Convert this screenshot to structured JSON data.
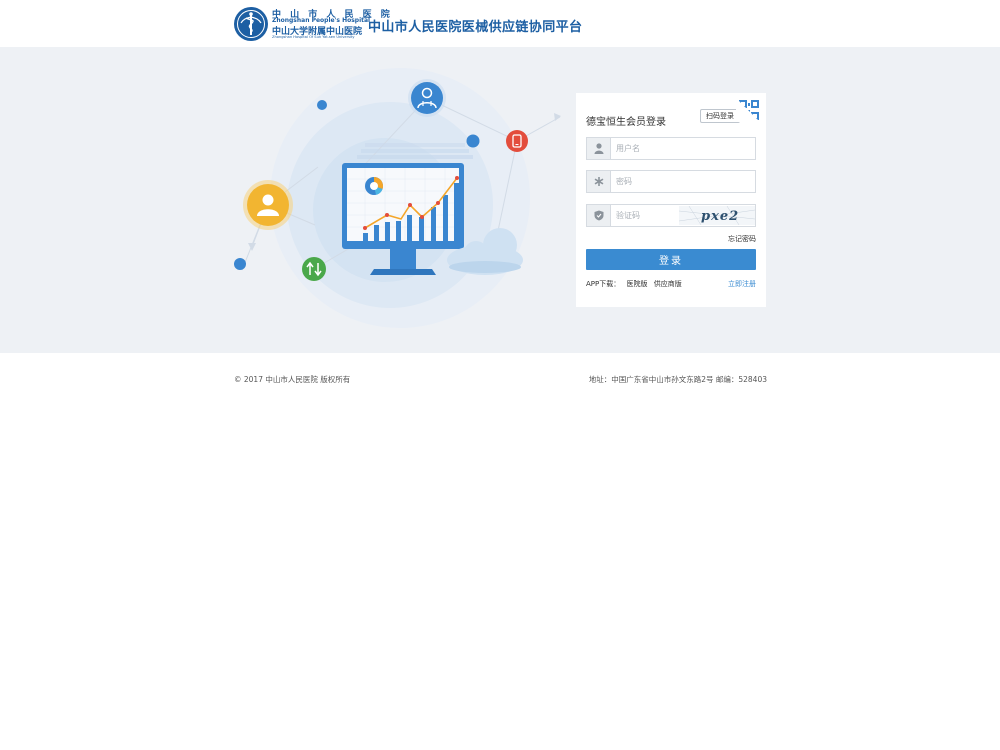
{
  "header": {
    "logo_cn": "中 山 市 人 民 医 院",
    "logo_en": "Zhongshan People's Hospital",
    "logo_cn2": "中山大学附属中山医院",
    "logo_en2": "Zhongshan Hospital Of Sun Yat-sen University",
    "site_title": "中山市人民医院医械供应链协同平台"
  },
  "login": {
    "title": "德宝恒生会员登录",
    "scan_label": "扫码登录",
    "username_placeholder": "用户名",
    "password_placeholder": "密码",
    "captcha_placeholder": "验证码",
    "captcha_text": "pxe2",
    "forgot_label": "忘记密码",
    "submit_label": "登录",
    "app_download_label": "APP下载：",
    "app_hospital_label": "医院版",
    "app_supplier_label": "供应商版",
    "register_label": "立即注册"
  },
  "footer": {
    "copyright": "© 2017 中山市人民医院 版权所有",
    "address": "地址：中国广东省中山市孙文东路2号 邮编：528403"
  },
  "colors": {
    "brand": "#1d5fa3",
    "primary_button": "#3a8bd1",
    "banner_bg": "#eef1f5"
  },
  "icons": {
    "username": "user-icon",
    "password": "asterisk-icon",
    "captcha": "shield-icon",
    "qr": "qr-code-icon"
  }
}
